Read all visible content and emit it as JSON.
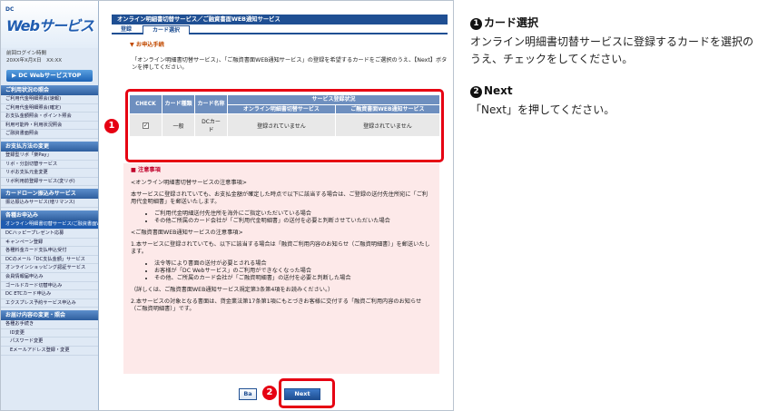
{
  "sidebar": {
    "logo_dc": "DC",
    "logo_name": "Webサービス",
    "login_label": "前回ログイン時間",
    "login_time": "20XX年X月X日　XX:XX",
    "top_button": "▶ DC WebサービスTOP",
    "sections": [
      {
        "title": "ご利用状況の照会",
        "items": [
          "ご利用代金明細照会(速報)",
          "ご利用代金明細照会(確定)",
          "お支払金額照会・ポイント照会",
          "利用可能枠・利用状況照会",
          "ご融資書面照会"
        ]
      },
      {
        "title": "お支払方法の変更",
        "items": [
          "登録型リボ「楽Pay」",
          "リボ・分割切替サービス",
          "リボお支払元金変更",
          "リボ利用前登録サービス(変リボ)"
        ]
      },
      {
        "title": "カードローン振込みサービス",
        "items": [
          "振込振込みサービス(増リマンス)"
        ]
      },
      {
        "title": "各種お申込み",
        "items": [
          "オンライン明細書切替サービス/ご融資書面WEB通知サービス",
          "DCハッピープレゼント応募",
          "キャンペーン登録",
          "各種料金カード支払申込受付",
          "DCのメール「DC支払金額」サービス",
          "オンラインショッピング認証サービス",
          "会員情報届申込み",
          "ゴールドカード切替申込み",
          "DC ETCカード申込み",
          "エクスプレス予約サービス申込み"
        ]
      },
      {
        "title": "お届け内容の変更・照会",
        "items": [
          "各種お手続き",
          "ID変更",
          "パスワード変更",
          "Eメールアドレス登録・変更"
        ]
      }
    ]
  },
  "main": {
    "title": "オンライン明細書切替サービス／ご融資書面WEB通知サービス",
    "tabs": [
      "登録",
      "カード選択"
    ],
    "section_heading": "▼ お申込手続",
    "intro": "「オンライン明細書切替サービス」、「ご融資書面WEB通知サービス」の登録を希望するカードをご選択のうえ、【Next】ボタンを押してください。",
    "table": {
      "headers": {
        "check": "CHECK",
        "type": "カード種類",
        "name": "カード名称",
        "status": "サービス登録状況",
        "svc1": "オンライン明細書切替サービス",
        "svc2": "ご融資書面WEB通知サービス"
      },
      "rows": [
        {
          "check": "✓",
          "type": "一般",
          "name": "DCカード",
          "svc1": "登録されていません",
          "svc2": "登録されていません"
        }
      ]
    },
    "notice": {
      "heading": "■ 注意事項",
      "p1": "<オンライン明細書切替サービスの注意事項>",
      "p2": "本サービスに登録されていても、お支払金額が確定した時点で以下に該当する場合は、ご登録の送付先住所宛に「ご利用代金明細書」を郵送いたします。",
      "list1": [
        "ご利用代金明細送付先住所を海外にご指定いただいている場合",
        "その他ご所属のカード会社が「ご利用代金明細書」の送付を必要と判断させていただいた場合"
      ],
      "p3": "<ご融資書面WEB通知サービスの注意事項>",
      "p4": "1.本サービスに登録されていても、以下に該当する場合は「融資ご利用内容のお知らせ（ご融資明細書）」を郵送いたします。",
      "list2": [
        "法令等により書面の送付が必要とされる場合",
        "お客様が「DC Webサービス」のご利用ができなくなった場合",
        "その他、ご所属のカード会社が「ご融資明細書」の送付を必要と判断した場合"
      ],
      "p5": "（詳しくは、ご融資書面WEB通知サービス規定第3条第4項をお読みください。）",
      "p6": "2.本サービスの対象となる書面は、貸金業法第17条第1項にもとづきお客様に交付する「融資ご利用内容のお知らせ（ご融資明細書）」です。"
    },
    "buttons": {
      "back": "Ba",
      "next": "Next"
    }
  },
  "annotations": {
    "badge1": "1",
    "badge2": "2",
    "color": "#e60012"
  },
  "instructions": {
    "step1": {
      "num": "1",
      "title": "カード選択",
      "text": "オンライン明細書切替サービスに登録するカードを選択のうえ、チェックをしてください。"
    },
    "step2": {
      "num": "2",
      "title": "Next",
      "text": "「Next」を押してください。"
    }
  }
}
